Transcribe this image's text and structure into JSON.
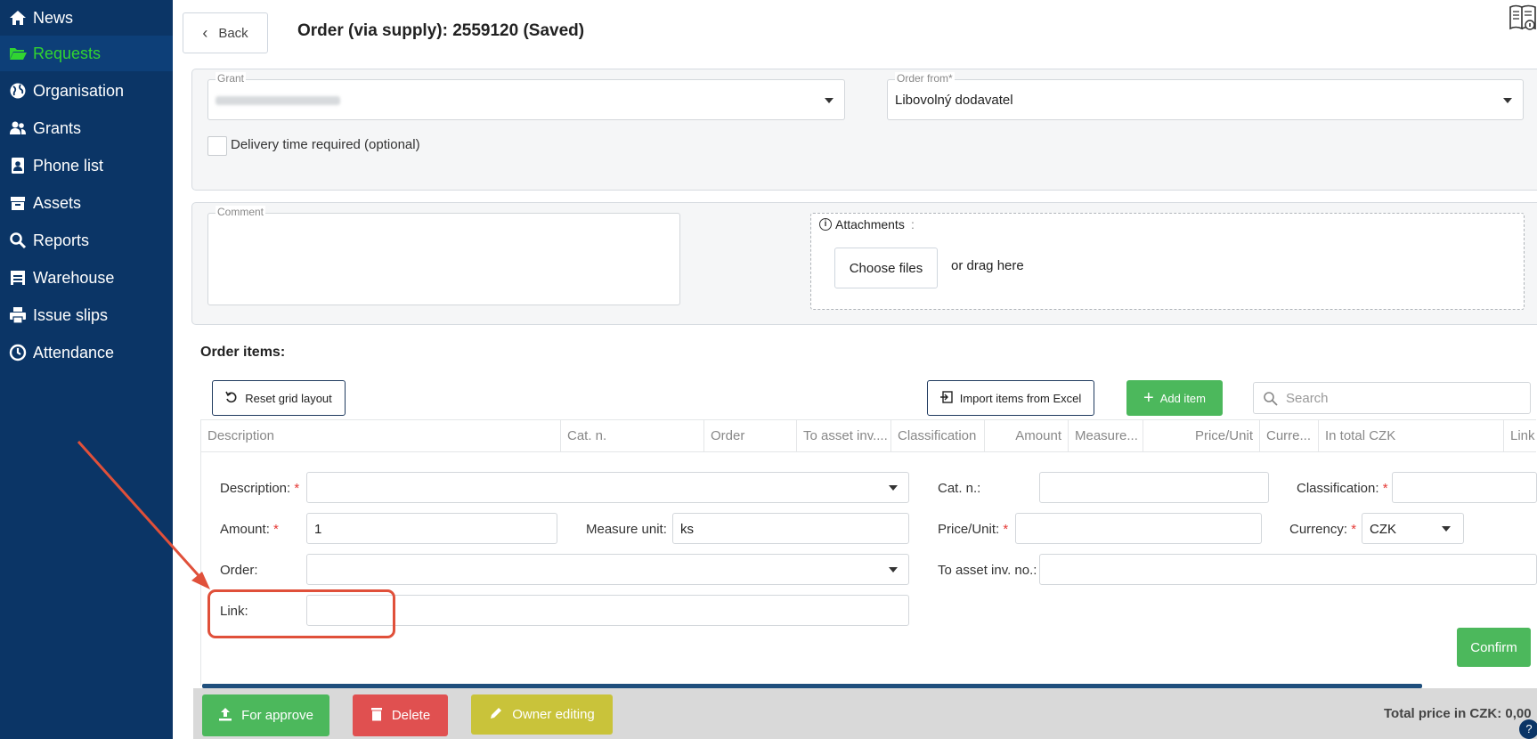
{
  "sidebar": {
    "items": [
      {
        "label": "News",
        "icon": "home-icon"
      },
      {
        "label": "Requests",
        "icon": "folder-open-icon",
        "active": true
      },
      {
        "label": "Organisation",
        "icon": "globe-icon"
      },
      {
        "label": "Grants",
        "icon": "users-icon"
      },
      {
        "label": "Phone list",
        "icon": "contact-card-icon"
      },
      {
        "label": "Assets",
        "icon": "archive-icon"
      },
      {
        "label": "Reports",
        "icon": "search-icon"
      },
      {
        "label": "Warehouse",
        "icon": "warehouse-icon"
      },
      {
        "label": "Issue slips",
        "icon": "print-icon"
      },
      {
        "label": "Attendance",
        "icon": "clock-icon"
      }
    ]
  },
  "header": {
    "back_label": "Back",
    "title": "Order (via supply): 2559120 (Saved)"
  },
  "form": {
    "grant_legend": "Grant",
    "grant_value": "",
    "order_from_legend": "Order from*",
    "order_from_value": "Libovolný dodavatel",
    "delivery_label": "Delivery time required (optional)",
    "comment_legend": "Comment",
    "attachments_label": "Attachments",
    "choose_files_label": "Choose files",
    "drag_label": "or drag here"
  },
  "items": {
    "heading": "Order items:",
    "reset_label": "Reset grid layout",
    "import_label": "Import items from Excel",
    "add_label": "Add item",
    "search_placeholder": "Search",
    "columns": [
      "Description",
      "Cat. n.",
      "Order",
      "To asset inv....",
      "Classification",
      "Amount",
      "Measure...",
      "Price/Unit",
      "Curre...",
      "In total CZK",
      "Link"
    ]
  },
  "editor": {
    "description_label": "Description:",
    "cat_label": "Cat. n.:",
    "classification_label": "Classification:",
    "amount_label": "Amount:",
    "amount_value": "1",
    "measure_label": "Measure unit:",
    "measure_value": "ks",
    "price_label": "Price/Unit:",
    "currency_label": "Currency:",
    "currency_value": "CZK",
    "order_label": "Order:",
    "asset_label": "To asset inv. no.:",
    "link_label": "Link:",
    "required_mark": "*",
    "confirm_label": "Confirm"
  },
  "footer": {
    "approve_label": "For approve",
    "delete_label": "Delete",
    "owner_label": "Owner editing",
    "total_label": "Total price in CZK: 0,00"
  },
  "colors": {
    "sidebar_bg": "#0b3566",
    "active_nav": "#31d431",
    "green": "#4cb85c",
    "red": "#e05050",
    "olive": "#c9c33a",
    "highlight": "#e0503a"
  }
}
